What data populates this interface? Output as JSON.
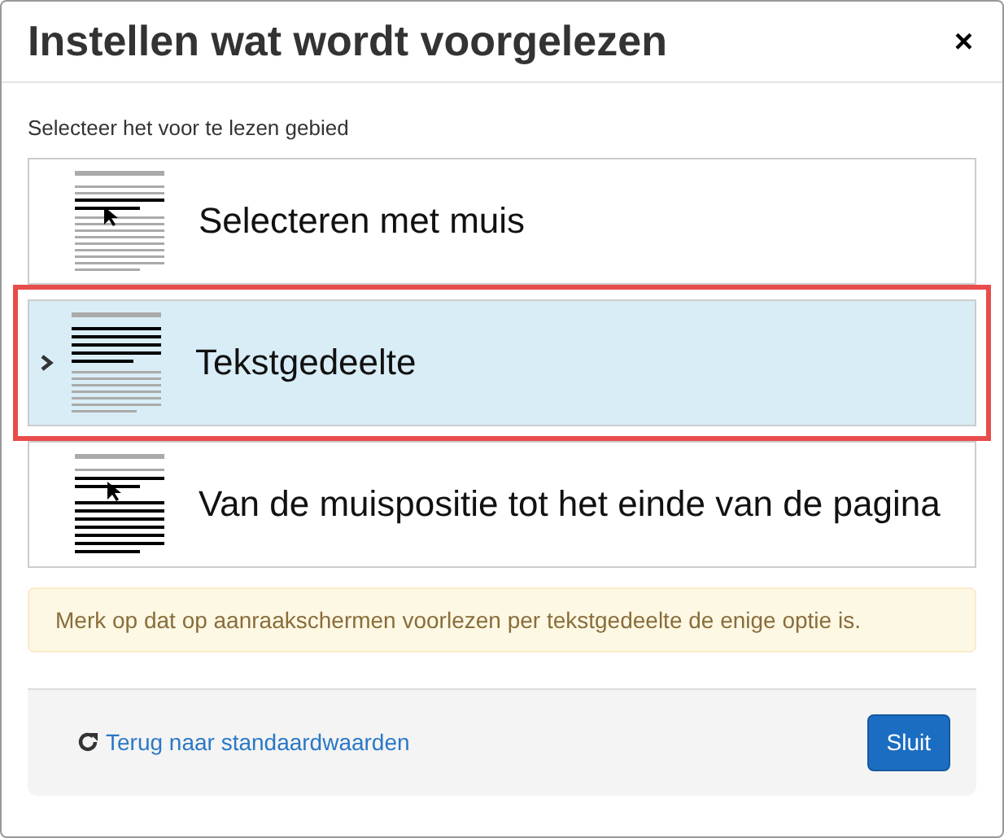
{
  "dialog": {
    "title": "Instellen wat wordt voorgelezen",
    "close": "×"
  },
  "area_label": "Selecteer het voor te lezen gebied",
  "options": [
    {
      "label": "Selecteren met muis",
      "kind": "mouse-select",
      "selected": false
    },
    {
      "label": "Tekstgedeelte",
      "kind": "text-block",
      "selected": true
    },
    {
      "label": "Van de muispositie tot het einde van de pagina",
      "kind": "from-mouse",
      "selected": false
    }
  ],
  "notice": "Merk op dat op aanraakschermen voorlezen per tekstgedeelte de enige optie is.",
  "footer": {
    "reset_link": "Terug naar standaardwaarden",
    "close_button": "Sluit"
  }
}
